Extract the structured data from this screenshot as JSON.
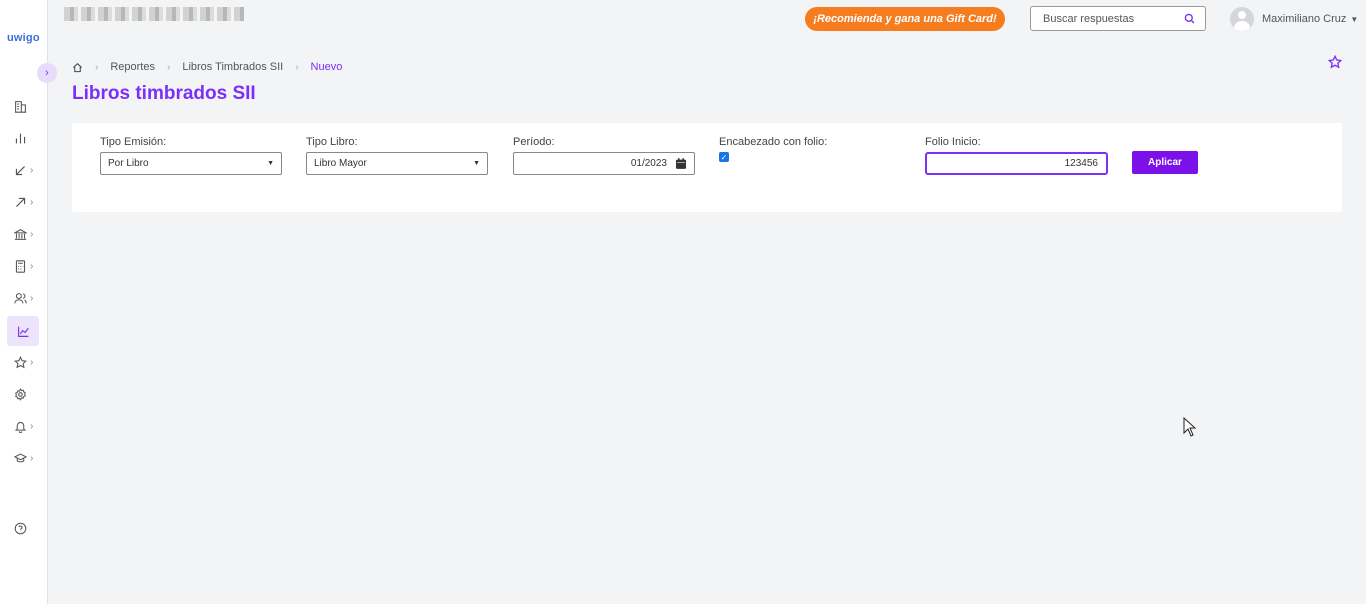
{
  "brand": {
    "logo_text": "uwigo",
    "accent": "#7b2ff7",
    "promo_color": "#f57c1f"
  },
  "sidebar": {
    "items": [
      {
        "icon": "building-icon",
        "has_submenu": false
      },
      {
        "icon": "bar-chart-icon",
        "has_submenu": false
      },
      {
        "icon": "arrow-down-left-icon",
        "has_submenu": true
      },
      {
        "icon": "arrow-up-right-icon",
        "has_submenu": true
      },
      {
        "icon": "bank-icon",
        "has_submenu": true
      },
      {
        "icon": "calculator-icon",
        "has_submenu": true
      },
      {
        "icon": "users-icon",
        "has_submenu": true
      },
      {
        "icon": "line-chart-icon",
        "has_submenu": false,
        "active": true
      },
      {
        "icon": "star-icon",
        "has_submenu": true
      },
      {
        "icon": "settings-icon",
        "has_submenu": false
      },
      {
        "icon": "bell-icon",
        "has_submenu": true
      },
      {
        "icon": "graduation-cap-icon",
        "has_submenu": true
      },
      {
        "icon": "help-icon",
        "has_submenu": false
      }
    ]
  },
  "header": {
    "promo_label": "¡Recomienda y gana una Gift Card!",
    "search_placeholder": "Buscar respuestas",
    "user_name": "Maximiliano Cruz"
  },
  "breadcrumb": {
    "items": [
      "Reportes",
      "Libros Timbrados SII"
    ],
    "current": "Nuevo"
  },
  "page": {
    "title": "Libros timbrados SII"
  },
  "filters": {
    "tipo_emision": {
      "label": "Tipo Emisión:",
      "value": "Por Libro"
    },
    "tipo_libro": {
      "label": "Tipo Libro:",
      "value": "Libro Mayor"
    },
    "periodo": {
      "label": "Período:",
      "value": "01/2023"
    },
    "encabezado": {
      "label": "Encabezado con folio:",
      "checked": true
    },
    "folio_inicio": {
      "label": "Folio Inicio:",
      "value": "123456"
    },
    "apply_label": "Aplicar"
  }
}
